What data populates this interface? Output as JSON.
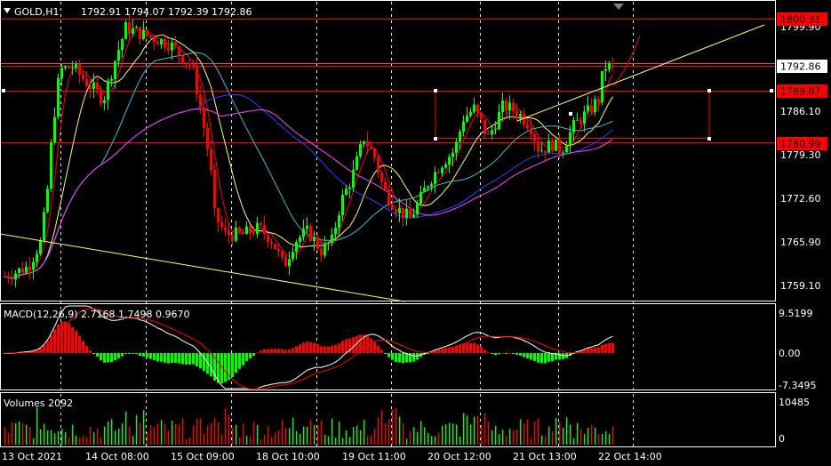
{
  "main": {
    "symbol": "GOLD,H1",
    "ohlc": "1792.91 1794.07 1792.39 1792.86",
    "price_labels": [
      "1799.90",
      "1786.10",
      "1779.30",
      "1772.60",
      "1765.90",
      "1759.10"
    ],
    "hline_badges": [
      {
        "text": "1800.31",
        "bg": "#ff0000",
        "fg": "#000000"
      },
      {
        "text": "1792.86",
        "bg": "#ffffff",
        "fg": "#000000"
      },
      {
        "text": "1789.07",
        "bg": "#ff0000",
        "fg": "#000000"
      },
      {
        "text": "1780.99",
        "bg": "#ff0000",
        "fg": "#000000"
      }
    ]
  },
  "macd": {
    "label": "MACD(12,26,9) 2.7168 1.7498 0.9670",
    "levels": [
      "9.5199",
      "0.00",
      "-7.3495"
    ]
  },
  "volumes": {
    "label": "Volumes 2092",
    "levels": [
      "10485",
      "0"
    ]
  },
  "time_labels": [
    "13 Oct 2021",
    "14 Oct 08:00",
    "15 Oct 09:00",
    "18 Oct 10:00",
    "19 Oct 11:00",
    "20 Oct 12:00",
    "21 Oct 13:00",
    "22 Oct 14:00"
  ],
  "colors": {
    "bull": "#00ff00",
    "bear": "#ff0000",
    "grid": "#ffffff",
    "ma_red": "#ff0000",
    "ma_yellow": "#ffff66",
    "ma_cyan": "#40c0d0",
    "ma_blue": "#3040ff",
    "ma_magenta": "#ff40ff",
    "trendline": "#ffff66"
  }
}
